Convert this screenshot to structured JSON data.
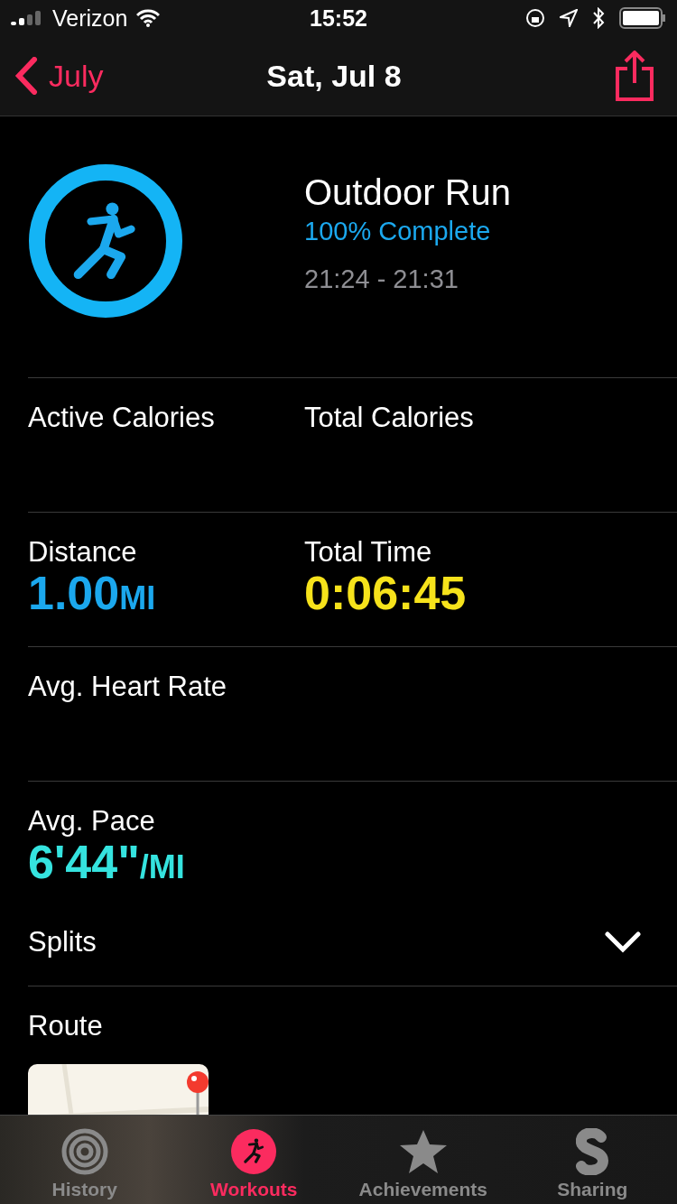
{
  "status_bar": {
    "carrier": "Verizon",
    "time": "15:52"
  },
  "nav": {
    "back": "July",
    "title": "Sat, Jul 8"
  },
  "workout": {
    "title": "Outdoor Run",
    "completion": "100% Complete",
    "time_range": "21:24 - 21:31"
  },
  "metric_rows": [
    [
      {
        "label": "Active Calories"
      },
      {
        "label": "Total Calories"
      }
    ],
    [
      {
        "label": "Distance",
        "value": "1.00",
        "unit": "MI",
        "color": "#1ba8ee"
      },
      {
        "label": "Total Time",
        "value": "0:06:45",
        "color": "#f6e21b"
      }
    ],
    [
      {
        "label": "Avg. Heart Rate"
      }
    ],
    [
      {
        "label": "Avg. Pace",
        "value": "6'44\"",
        "unit": "/MI",
        "color": "#35e3df"
      }
    ]
  ],
  "splits": {
    "label": "Splits",
    "expanded": false
  },
  "route": {
    "label": "Route"
  },
  "tabs": [
    {
      "label": "History",
      "selected": false
    },
    {
      "label": "Workouts",
      "selected": true
    },
    {
      "label": "Achievements",
      "selected": false
    },
    {
      "label": "Sharing",
      "selected": false
    }
  ]
}
